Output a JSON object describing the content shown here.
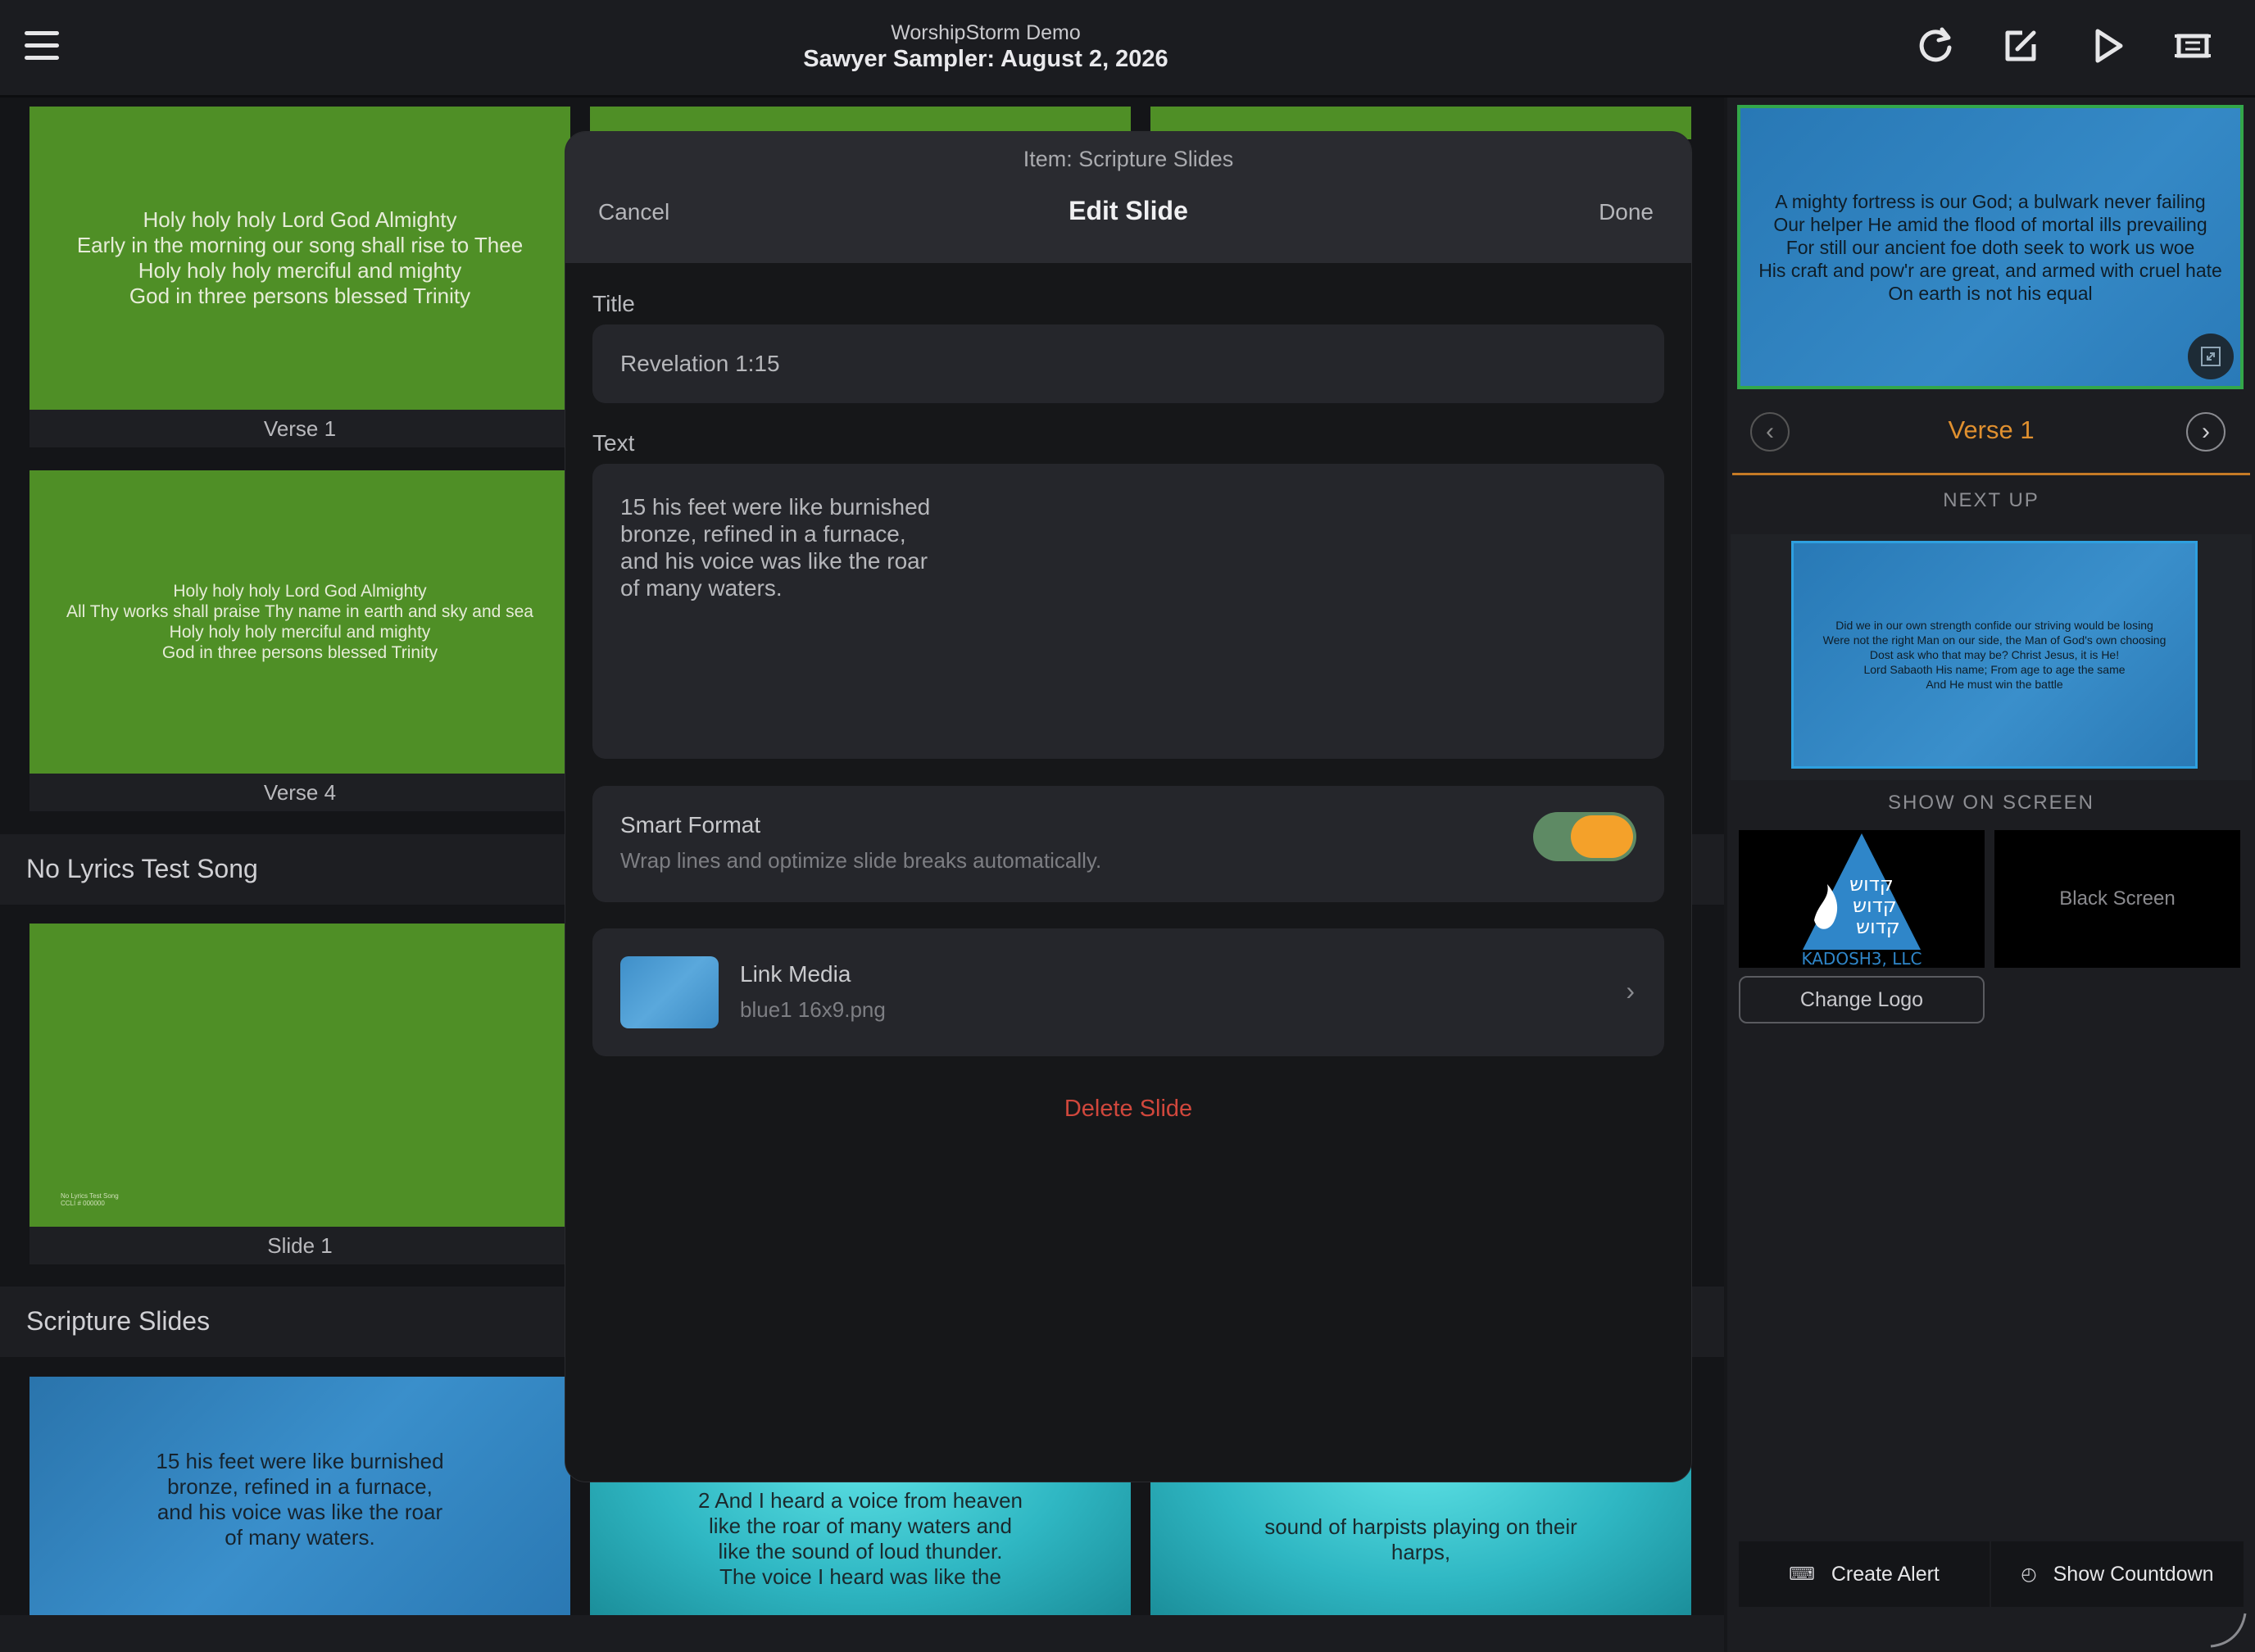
{
  "header": {
    "app_name": "WorshipStorm Demo",
    "title": "Sawyer Sampler: August 2, 2026",
    "icons": [
      "refresh-icon",
      "edit-icon",
      "play-icon",
      "screen-icon"
    ]
  },
  "left": {
    "song1": {
      "slides": [
        {
          "lines": "Holy holy holy Lord God Almighty\nEarly in the morning our song shall rise to Thee\nHoly holy holy merciful and mighty\nGod in three persons blessed Trinity",
          "caption": "Verse 1"
        },
        {
          "lines": "Holy holy holy Lord God Almighty\nAll Thy works shall praise Thy name in earth and sky and sea\nHoly holy holy merciful and mighty\nGod in three persons blessed Trinity",
          "caption": "Verse 4"
        }
      ]
    },
    "song2": {
      "header": "No Lyrics Test Song",
      "slide_caption": "Slide 1",
      "slide_small_text": "No Lyrics Test Song\nCCLI # 000000"
    },
    "scripture": {
      "header": "Scripture Slides",
      "slides": [
        {
          "text": "15 his feet were like burnished\nbronze, refined in a furnace,\nand his voice was like the roar\nof many waters."
        },
        {
          "text": "2 And I heard a voice from heaven\nlike the roar of many waters and\nlike the sound of loud thunder.\nThe voice I heard was like the"
        },
        {
          "text": "sound of harpists playing on their\nharps,"
        }
      ]
    }
  },
  "modal": {
    "item_label": "Item: Scripture Slides",
    "title": "Edit Slide",
    "cancel": "Cancel",
    "done": "Done",
    "title_label": "Title",
    "title_value": "Revelation 1:15",
    "text_label": "Text",
    "text_value": "15 his feet were like burnished\nbronze, refined in a furnace,\nand his voice was like the roar\nof many waters.",
    "smart_format_title": "Smart Format",
    "smart_format_sub": "Wrap lines and optimize slide breaks automatically.",
    "smart_format_on": true,
    "link_media_title": "Link Media",
    "link_media_file": "blue1 16x9.png",
    "delete_label": "Delete Slide"
  },
  "right": {
    "preview_text": "A mighty fortress is our God; a bulwark never failing\nOur helper He amid the flood of mortal ills prevailing\nFor still our ancient foe doth seek to work us woe\nHis craft and pow'r are great, and armed with cruel hate\nOn earth is not his equal",
    "current_label": "Verse 1",
    "next_up_heading": "NEXT UP",
    "next_text": "Did we in our own strength confide our striving would be losing\nWere not the right Man on our side, the Man of God's own choosing\nDost ask who that may be? Christ Jesus, it is He!\nLord Sabaoth His name; From age to age the same\nAnd He must win the battle",
    "show_heading": "SHOW ON SCREEN",
    "logo_text": "KADOSH3, LLC",
    "black_screen": "Black Screen",
    "change_logo": "Change Logo",
    "create_alert": "Create Alert",
    "show_countdown": "Show Countdown"
  },
  "colors": {
    "accent_orange": "#f4a12a",
    "slide_green": "#4f8f26",
    "danger_red": "#d0473c",
    "live_border_green": "#33a74a"
  }
}
